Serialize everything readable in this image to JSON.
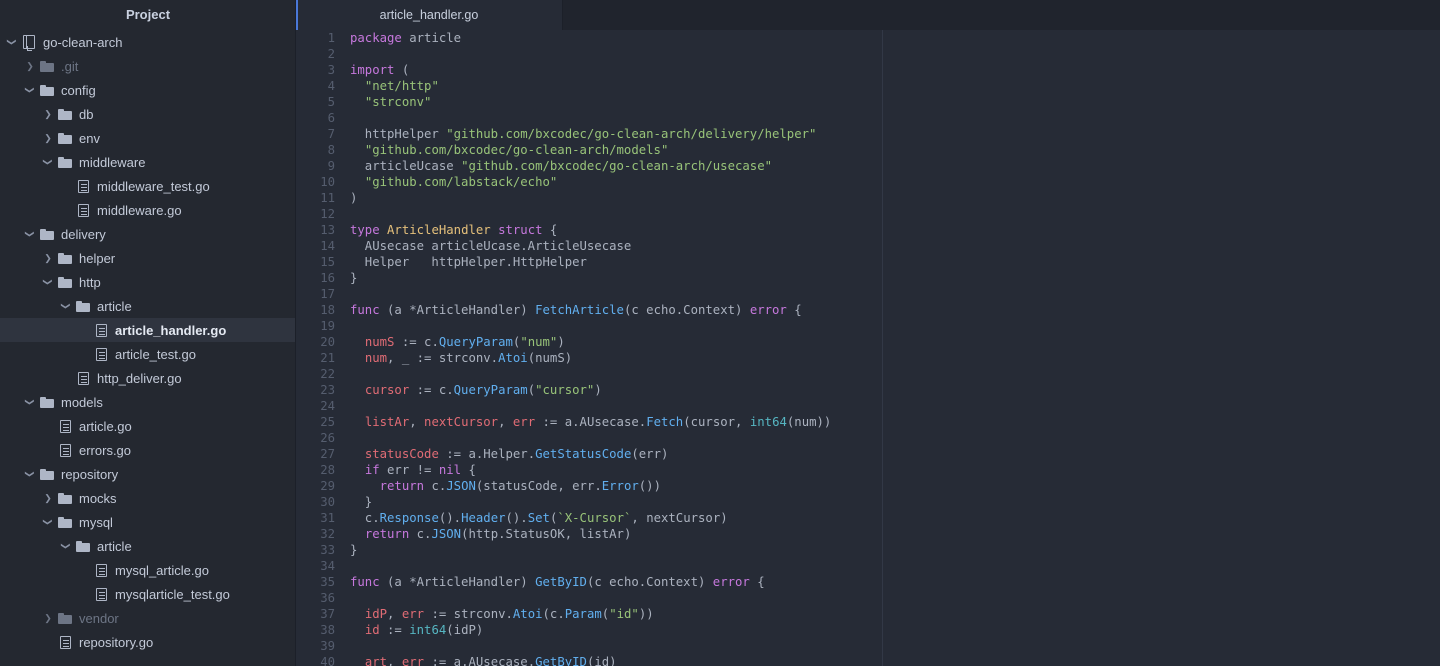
{
  "window": {
    "accent_color": "#4a78d8",
    "sidebar_bg": "#242830",
    "editor_bg": "#262b36"
  },
  "sidebar": {
    "header_title": "Project",
    "tree": [
      {
        "label": "go-clean-arch",
        "depth": 0,
        "icon": "module-icon",
        "arrow": "down",
        "selected": false,
        "dim": false
      },
      {
        "label": ".git",
        "depth": 1,
        "icon": "folder-icon",
        "arrow": "right",
        "selected": false,
        "dim": true
      },
      {
        "label": "config",
        "depth": 1,
        "icon": "folder-icon",
        "arrow": "down",
        "selected": false,
        "dim": false
      },
      {
        "label": "db",
        "depth": 2,
        "icon": "folder-icon",
        "arrow": "right",
        "selected": false,
        "dim": false
      },
      {
        "label": "env",
        "depth": 2,
        "icon": "folder-icon",
        "arrow": "right",
        "selected": false,
        "dim": false
      },
      {
        "label": "middleware",
        "depth": 2,
        "icon": "folder-icon",
        "arrow": "down",
        "selected": false,
        "dim": false
      },
      {
        "label": "middleware_test.go",
        "depth": 3,
        "icon": "file-icon",
        "arrow": "none",
        "selected": false,
        "dim": false
      },
      {
        "label": "middleware.go",
        "depth": 3,
        "icon": "file-icon",
        "arrow": "none",
        "selected": false,
        "dim": false
      },
      {
        "label": "delivery",
        "depth": 1,
        "icon": "folder-icon",
        "arrow": "down",
        "selected": false,
        "dim": false
      },
      {
        "label": "helper",
        "depth": 2,
        "icon": "folder-icon",
        "arrow": "right",
        "selected": false,
        "dim": false
      },
      {
        "label": "http",
        "depth": 2,
        "icon": "folder-icon",
        "arrow": "down",
        "selected": false,
        "dim": false
      },
      {
        "label": "article",
        "depth": 3,
        "icon": "folder-icon",
        "arrow": "down",
        "selected": false,
        "dim": false
      },
      {
        "label": "article_handler.go",
        "depth": 4,
        "icon": "file-icon",
        "arrow": "none",
        "selected": true,
        "dim": false
      },
      {
        "label": "article_test.go",
        "depth": 4,
        "icon": "file-icon",
        "arrow": "none",
        "selected": false,
        "dim": false
      },
      {
        "label": "http_deliver.go",
        "depth": 3,
        "icon": "file-icon",
        "arrow": "none",
        "selected": false,
        "dim": false
      },
      {
        "label": "models",
        "depth": 1,
        "icon": "folder-icon",
        "arrow": "down",
        "selected": false,
        "dim": false
      },
      {
        "label": "article.go",
        "depth": 2,
        "icon": "file-icon",
        "arrow": "none",
        "selected": false,
        "dim": false
      },
      {
        "label": "errors.go",
        "depth": 2,
        "icon": "file-icon",
        "arrow": "none",
        "selected": false,
        "dim": false
      },
      {
        "label": "repository",
        "depth": 1,
        "icon": "folder-icon",
        "arrow": "down",
        "selected": false,
        "dim": false
      },
      {
        "label": "mocks",
        "depth": 2,
        "icon": "folder-icon",
        "arrow": "right",
        "selected": false,
        "dim": false
      },
      {
        "label": "mysql",
        "depth": 2,
        "icon": "folder-icon",
        "arrow": "down",
        "selected": false,
        "dim": false
      },
      {
        "label": "article",
        "depth": 3,
        "icon": "folder-icon",
        "arrow": "down",
        "selected": false,
        "dim": false
      },
      {
        "label": "mysql_article.go",
        "depth": 4,
        "icon": "file-icon",
        "arrow": "none",
        "selected": false,
        "dim": false
      },
      {
        "label": "mysqlarticle_test.go",
        "depth": 4,
        "icon": "file-icon",
        "arrow": "none",
        "selected": false,
        "dim": false
      },
      {
        "label": "vendor",
        "depth": 2,
        "icon": "folder-icon",
        "arrow": "right",
        "selected": false,
        "dim": true
      },
      {
        "label": "repository.go",
        "depth": 2,
        "icon": "file-icon",
        "arrow": "none",
        "selected": false,
        "dim": false
      }
    ]
  },
  "editor": {
    "tabs": [
      {
        "label": "article_handler.go",
        "active": true
      }
    ],
    "language": "go",
    "lines": [
      {
        "n": 1,
        "tokens": [
          {
            "t": "package",
            "c": "kw"
          },
          {
            "t": " article",
            "c": "pl"
          }
        ]
      },
      {
        "n": 2,
        "tokens": []
      },
      {
        "n": 3,
        "tokens": [
          {
            "t": "import",
            "c": "kw"
          },
          {
            "t": " (",
            "c": "pun"
          }
        ]
      },
      {
        "n": 4,
        "tokens": [
          {
            "t": "  ",
            "c": "pl"
          },
          {
            "t": "\"net/http\"",
            "c": "str"
          }
        ]
      },
      {
        "n": 5,
        "tokens": [
          {
            "t": "  ",
            "c": "pl"
          },
          {
            "t": "\"strconv\"",
            "c": "str"
          }
        ]
      },
      {
        "n": 6,
        "tokens": []
      },
      {
        "n": 7,
        "tokens": [
          {
            "t": "  httpHelper ",
            "c": "pl"
          },
          {
            "t": "\"github.com/bxcodec/go-clean-arch/delivery/helper\"",
            "c": "str"
          }
        ]
      },
      {
        "n": 8,
        "tokens": [
          {
            "t": "  ",
            "c": "pl"
          },
          {
            "t": "\"github.com/bxcodec/go-clean-arch/models\"",
            "c": "str"
          }
        ]
      },
      {
        "n": 9,
        "tokens": [
          {
            "t": "  articleUcase ",
            "c": "pl"
          },
          {
            "t": "\"github.com/bxcodec/go-clean-arch/usecase\"",
            "c": "str"
          }
        ]
      },
      {
        "n": 10,
        "tokens": [
          {
            "t": "  ",
            "c": "pl"
          },
          {
            "t": "\"github.com/labstack/echo\"",
            "c": "str"
          }
        ]
      },
      {
        "n": 11,
        "tokens": [
          {
            "t": ")",
            "c": "pun"
          }
        ]
      },
      {
        "n": 12,
        "tokens": []
      },
      {
        "n": 13,
        "tokens": [
          {
            "t": "type",
            "c": "kw"
          },
          {
            "t": " ",
            "c": "pl"
          },
          {
            "t": "ArticleHandler",
            "c": "typ"
          },
          {
            "t": " ",
            "c": "pl"
          },
          {
            "t": "struct",
            "c": "kw"
          },
          {
            "t": " {",
            "c": "pun"
          }
        ]
      },
      {
        "n": 14,
        "tokens": [
          {
            "t": "  AUsecase articleUcase.ArticleUsecase",
            "c": "pl"
          }
        ]
      },
      {
        "n": 15,
        "tokens": [
          {
            "t": "  Helper   httpHelper.HttpHelper",
            "c": "pl"
          }
        ]
      },
      {
        "n": 16,
        "tokens": [
          {
            "t": "}",
            "c": "pun"
          }
        ]
      },
      {
        "n": 17,
        "tokens": []
      },
      {
        "n": 18,
        "tokens": [
          {
            "t": "func",
            "c": "kw"
          },
          {
            "t": " (a *ArticleHandler) ",
            "c": "pl"
          },
          {
            "t": "FetchArticle",
            "c": "fn"
          },
          {
            "t": "(c echo.Context) ",
            "c": "pl"
          },
          {
            "t": "error",
            "c": "kw"
          },
          {
            "t": " {",
            "c": "pun"
          }
        ]
      },
      {
        "n": 19,
        "tokens": []
      },
      {
        "n": 20,
        "tokens": [
          {
            "t": "  ",
            "c": "pl"
          },
          {
            "t": "numS",
            "c": "var"
          },
          {
            "t": " := c.",
            "c": "pl"
          },
          {
            "t": "QueryParam",
            "c": "fn"
          },
          {
            "t": "(",
            "c": "pun"
          },
          {
            "t": "\"num\"",
            "c": "str"
          },
          {
            "t": ")",
            "c": "pun"
          }
        ]
      },
      {
        "n": 21,
        "tokens": [
          {
            "t": "  ",
            "c": "pl"
          },
          {
            "t": "num",
            "c": "var"
          },
          {
            "t": ", _ := strconv.",
            "c": "pl"
          },
          {
            "t": "Atoi",
            "c": "fn"
          },
          {
            "t": "(numS)",
            "c": "pl"
          }
        ]
      },
      {
        "n": 22,
        "tokens": []
      },
      {
        "n": 23,
        "tokens": [
          {
            "t": "  ",
            "c": "pl"
          },
          {
            "t": "cursor",
            "c": "var"
          },
          {
            "t": " := c.",
            "c": "pl"
          },
          {
            "t": "QueryParam",
            "c": "fn"
          },
          {
            "t": "(",
            "c": "pun"
          },
          {
            "t": "\"cursor\"",
            "c": "str"
          },
          {
            "t": ")",
            "c": "pun"
          }
        ]
      },
      {
        "n": 24,
        "tokens": []
      },
      {
        "n": 25,
        "tokens": [
          {
            "t": "  ",
            "c": "pl"
          },
          {
            "t": "listAr",
            "c": "var"
          },
          {
            "t": ", ",
            "c": "pl"
          },
          {
            "t": "nextCursor",
            "c": "var"
          },
          {
            "t": ", ",
            "c": "pl"
          },
          {
            "t": "err",
            "c": "var"
          },
          {
            "t": " := a.AUsecase.",
            "c": "pl"
          },
          {
            "t": "Fetch",
            "c": "fn"
          },
          {
            "t": "(cursor, ",
            "c": "pl"
          },
          {
            "t": "int64",
            "c": "num"
          },
          {
            "t": "(num))",
            "c": "pl"
          }
        ]
      },
      {
        "n": 26,
        "tokens": []
      },
      {
        "n": 27,
        "tokens": [
          {
            "t": "  ",
            "c": "pl"
          },
          {
            "t": "statusCode",
            "c": "var"
          },
          {
            "t": " := a.Helper.",
            "c": "pl"
          },
          {
            "t": "GetStatusCode",
            "c": "fn"
          },
          {
            "t": "(err)",
            "c": "pl"
          }
        ]
      },
      {
        "n": 28,
        "tokens": [
          {
            "t": "  ",
            "c": "pl"
          },
          {
            "t": "if",
            "c": "kw"
          },
          {
            "t": " err != ",
            "c": "pl"
          },
          {
            "t": "nil",
            "c": "kw"
          },
          {
            "t": " {",
            "c": "pun"
          }
        ]
      },
      {
        "n": 29,
        "tokens": [
          {
            "t": "    ",
            "c": "pl"
          },
          {
            "t": "return",
            "c": "kw"
          },
          {
            "t": " c.",
            "c": "pl"
          },
          {
            "t": "JSON",
            "c": "fn"
          },
          {
            "t": "(statusCode, err.",
            "c": "pl"
          },
          {
            "t": "Error",
            "c": "fn"
          },
          {
            "t": "())",
            "c": "pl"
          }
        ]
      },
      {
        "n": 30,
        "tokens": [
          {
            "t": "  }",
            "c": "pun"
          }
        ]
      },
      {
        "n": 31,
        "tokens": [
          {
            "t": "  c.",
            "c": "pl"
          },
          {
            "t": "Response",
            "c": "fn"
          },
          {
            "t": "().",
            "c": "pl"
          },
          {
            "t": "Header",
            "c": "fn"
          },
          {
            "t": "().",
            "c": "pl"
          },
          {
            "t": "Set",
            "c": "fn"
          },
          {
            "t": "(",
            "c": "pun"
          },
          {
            "t": "`X-Cursor`",
            "c": "str"
          },
          {
            "t": ", nextCursor)",
            "c": "pl"
          }
        ]
      },
      {
        "n": 32,
        "tokens": [
          {
            "t": "  ",
            "c": "pl"
          },
          {
            "t": "return",
            "c": "kw"
          },
          {
            "t": " c.",
            "c": "pl"
          },
          {
            "t": "JSON",
            "c": "fn"
          },
          {
            "t": "(http.StatusOK, listAr)",
            "c": "pl"
          }
        ]
      },
      {
        "n": 33,
        "tokens": [
          {
            "t": "}",
            "c": "pun"
          }
        ]
      },
      {
        "n": 34,
        "tokens": []
      },
      {
        "n": 35,
        "tokens": [
          {
            "t": "func",
            "c": "kw"
          },
          {
            "t": " (a *ArticleHandler) ",
            "c": "pl"
          },
          {
            "t": "GetByID",
            "c": "fn"
          },
          {
            "t": "(c echo.Context) ",
            "c": "pl"
          },
          {
            "t": "error",
            "c": "kw"
          },
          {
            "t": " {",
            "c": "pun"
          }
        ]
      },
      {
        "n": 36,
        "tokens": []
      },
      {
        "n": 37,
        "tokens": [
          {
            "t": "  ",
            "c": "pl"
          },
          {
            "t": "idP",
            "c": "var"
          },
          {
            "t": ", ",
            "c": "pl"
          },
          {
            "t": "err",
            "c": "var"
          },
          {
            "t": " := strconv.",
            "c": "pl"
          },
          {
            "t": "Atoi",
            "c": "fn"
          },
          {
            "t": "(c.",
            "c": "pl"
          },
          {
            "t": "Param",
            "c": "fn"
          },
          {
            "t": "(",
            "c": "pun"
          },
          {
            "t": "\"id\"",
            "c": "str"
          },
          {
            "t": "))",
            "c": "pun"
          }
        ]
      },
      {
        "n": 38,
        "tokens": [
          {
            "t": "  ",
            "c": "pl"
          },
          {
            "t": "id",
            "c": "var"
          },
          {
            "t": " := ",
            "c": "pl"
          },
          {
            "t": "int64",
            "c": "num"
          },
          {
            "t": "(idP)",
            "c": "pl"
          }
        ]
      },
      {
        "n": 39,
        "tokens": []
      },
      {
        "n": 40,
        "tokens": [
          {
            "t": "  ",
            "c": "pl"
          },
          {
            "t": "art",
            "c": "var"
          },
          {
            "t": ", ",
            "c": "pl"
          },
          {
            "t": "err",
            "c": "var"
          },
          {
            "t": " := a.AUsecase.",
            "c": "pl"
          },
          {
            "t": "GetByID",
            "c": "fn"
          },
          {
            "t": "(id)",
            "c": "pl"
          }
        ]
      }
    ]
  }
}
